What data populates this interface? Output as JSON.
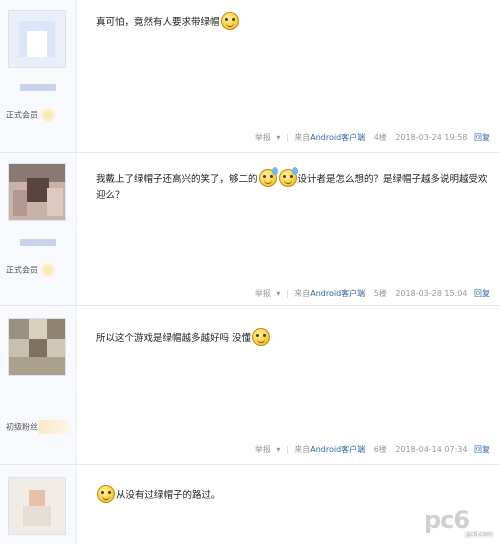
{
  "posts": [
    {
      "rank": "正式会员",
      "content": "真可怕，竟然有人要求带绿帽",
      "content_tail": "设计者是怎么想的？是绿帽子越多说明越受欢迎么？",
      "report": "举报",
      "client_prefix": "来自",
      "client": "Android客户端",
      "floor": "4楼",
      "time": "2018-03-24 19:58",
      "reply": "回复"
    },
    {
      "rank": "正式会员",
      "content": "我戴上了绿帽子还高兴的笑了，够二的",
      "content_tail": "设计者是怎么想的？是绿帽子越多说明越受欢迎么？",
      "report": "举报",
      "client_prefix": "来自",
      "client": "Android客户端",
      "floor": "5楼",
      "time": "2018-03-28 15:04",
      "reply": "回复"
    },
    {
      "rank": "初级粉丝",
      "content": "所以这个游戏是绿帽越多越好吗 没懂",
      "report": "举报",
      "client_prefix": "来自",
      "client": "Android客户端",
      "floor": "6楼",
      "time": "2018-04-14 07:34",
      "reply": "回复"
    },
    {
      "content": "从没有过绿帽子的路过。"
    }
  ],
  "watermark": {
    "text": "pc6",
    "sub": "pc6.com"
  },
  "colors": {
    "link": "#2d64b3",
    "meta": "#999999",
    "sidebar_bg": "#f7f9fc"
  }
}
